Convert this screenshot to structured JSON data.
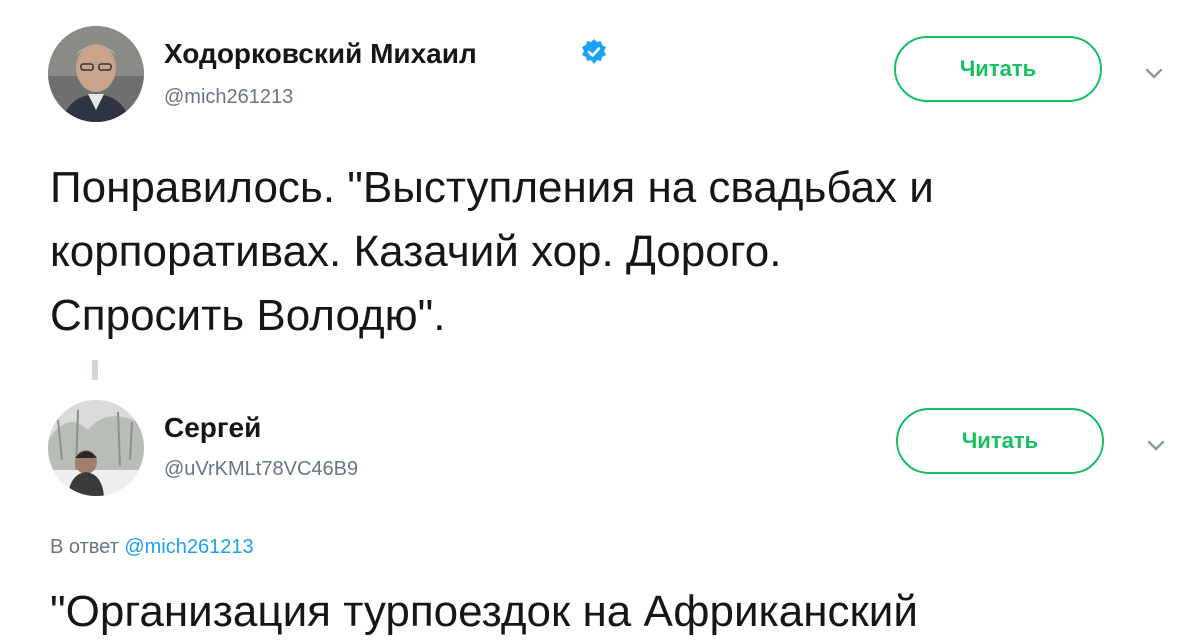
{
  "tweet1": {
    "display_name": "Ходорковский Михаил",
    "handle": "@mich261213",
    "follow_label": "Читать",
    "text_lines": [
      "Понравилось. \"Выступления на свадьбах и",
      "корпоративах. Казачий хор. Дорого.",
      "Спросить Володю\"."
    ],
    "verified": true
  },
  "tweet2": {
    "display_name": "Сергей",
    "handle": "@uVrKMLt78VC46B9",
    "follow_label": "Читать",
    "reply_prefix": "В ответ",
    "reply_mention": "@mich261213",
    "text_lines": [
      "\"Организация турпоездок на Африканский"
    ]
  },
  "colors": {
    "accent_green": "#17bf63",
    "link_blue": "#1da1f2",
    "secondary_text": "#657786",
    "verified_blue": "#1da1f2"
  }
}
